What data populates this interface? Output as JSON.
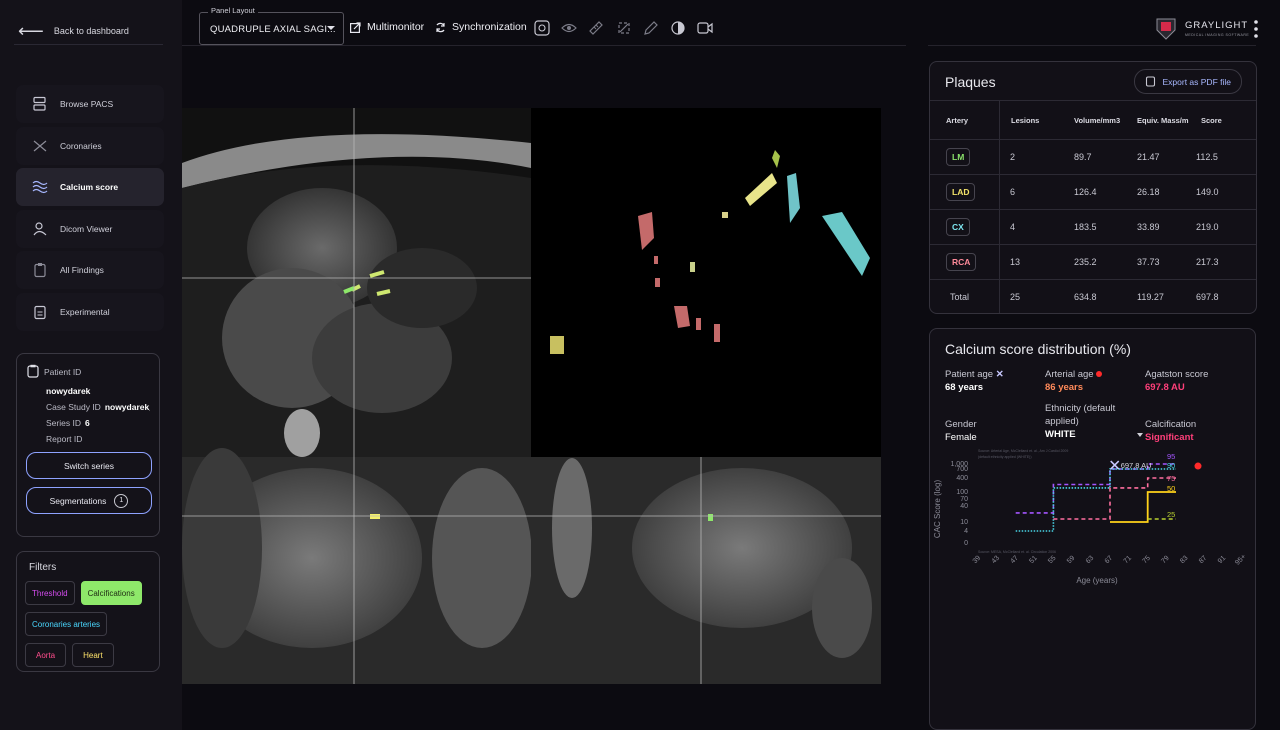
{
  "sidebar": {
    "back_label": "Back to dashboard",
    "nav": [
      {
        "label": "Browse PACS",
        "icon": "pacs-icon"
      },
      {
        "label": "Coronaries",
        "icon": "coronaries-icon"
      },
      {
        "label": "Calcium score",
        "icon": "calcium-icon",
        "active": true
      },
      {
        "label": "Dicom Viewer",
        "icon": "dicom-icon"
      },
      {
        "label": "All Findings",
        "icon": "findings-icon"
      },
      {
        "label": "Experimental",
        "icon": "experimental-icon"
      }
    ]
  },
  "patient": {
    "patient_id_label": "Patient ID",
    "patient_id_value": "nowydarek",
    "case_label": "Case Study ID",
    "case_value": "nowydarek_a...",
    "series_label": "Series ID",
    "series_value": "6",
    "report_label": "Report ID",
    "switch_label": "Switch series",
    "segmentations_label": "Segmentations",
    "segmentations_count": "1"
  },
  "filters": {
    "title": "Filters",
    "chips": [
      {
        "label": "Threshold",
        "color": "#d54cf0"
      },
      {
        "label": "Calcifications",
        "color": "#1d2a12",
        "active": true
      },
      {
        "label": "Coronaries arteries",
        "color": "#4ad7ff"
      },
      {
        "label": "Aorta",
        "color": "#ff4d8d"
      },
      {
        "label": "Heart",
        "color": "#ffe36b"
      }
    ]
  },
  "toolbar": {
    "layout_legend": "Panel Layout",
    "layout_value": "QUADRUPLE AXIAL SAGI...",
    "multimonitor_label": "Multimonitor",
    "sync_label": "Synchronization",
    "icons": [
      "crosshair-icon",
      "eye-icon",
      "ruler-icon",
      "rotate-icon",
      "pen-icon",
      "contrast-icon",
      "video-icon"
    ]
  },
  "brand": {
    "name": "GRAYLIGHT",
    "tagline": "MEDICAL IMAGING SOFTWARE"
  },
  "plaques": {
    "title": "Plaques",
    "export_label": "Export as PDF file",
    "headers": [
      "Artery",
      "Lesions",
      "Volume/mm3",
      "Equiv. Mass/m",
      "Score"
    ],
    "rows": [
      {
        "artery": "LM",
        "color": "#8be36b",
        "lesions": "2",
        "volume": "89.7",
        "mass": "21.47",
        "score": "112.5"
      },
      {
        "artery": "LAD",
        "color": "#f3e36a",
        "lesions": "6",
        "volume": "126.4",
        "mass": "26.18",
        "score": "149.0"
      },
      {
        "artery": "CX",
        "color": "#7ee6f0",
        "lesions": "4",
        "volume": "183.5",
        "mass": "33.89",
        "score": "219.0"
      },
      {
        "artery": "RCA",
        "color": "#ff8a9a",
        "lesions": "13",
        "volume": "235.2",
        "mass": "37.73",
        "score": "217.3"
      }
    ],
    "total": {
      "label": "Total",
      "lesions": "25",
      "volume": "634.8",
      "mass": "119.27",
      "score": "697.8"
    }
  },
  "distribution": {
    "title": "Calcium score distribution (%)",
    "patient_age_label": "Patient age",
    "patient_age_value": "68 years",
    "arterial_age_label": "Arterial age",
    "arterial_age_value": "86 years",
    "agatston_label": "Agatston score",
    "agatston_value": "697.8 AU",
    "gender_label": "Gender",
    "gender_value": "Female",
    "ethnicity_label": "Ethnicity (default applied)",
    "ethnicity_value": "WHITE",
    "calcification_label": "Calcification",
    "calcification_value": "Significant",
    "source_top": "Source: Arterial Age, McClelland et. al., Am J Cardiol 2009",
    "source_top2": "(default ethnicity applied (WHITE))",
    "source_bottom": "Source: MESA, McClelland et. al. Circulation 2006",
    "score_marker": "697.8 AU"
  },
  "chart_data": {
    "type": "line",
    "ylabel": "CAC Score (log)",
    "xlabel": "Age (years)",
    "x_ticks": [
      "39",
      "43",
      "47",
      "51",
      "55",
      "59",
      "63",
      "67",
      "71",
      "75",
      "79",
      "83",
      "87",
      "91",
      "95+"
    ],
    "y_ticks": [
      "1,000",
      "700",
      "400",
      "100",
      "70",
      "40",
      "10",
      "4",
      "0"
    ],
    "series": [
      {
        "name": "95",
        "color": "#a455ff",
        "values": [
          {
            "x": 47,
            "y": 22
          },
          {
            "x": 55,
            "y": 22
          },
          {
            "x": 55,
            "y": 210
          },
          {
            "x": 67,
            "y": 210
          },
          {
            "x": 67,
            "y": 700
          },
          {
            "x": 75,
            "y": 700
          },
          {
            "x": 75,
            "y": 1000
          },
          {
            "x": 81,
            "y": 1000
          }
        ]
      },
      {
        "name": "90",
        "color": "#49d6e8",
        "values": [
          {
            "x": 47,
            "y": 4
          },
          {
            "x": 55,
            "y": 4
          },
          {
            "x": 55,
            "y": 150
          },
          {
            "x": 67,
            "y": 150
          },
          {
            "x": 67,
            "y": 700
          },
          {
            "x": 81,
            "y": 700
          }
        ]
      },
      {
        "name": "75",
        "color": "#ff6fa0",
        "values": [
          {
            "x": 55,
            "y": 13
          },
          {
            "x": 67,
            "y": 13
          },
          {
            "x": 67,
            "y": 150
          },
          {
            "x": 75,
            "y": 150
          },
          {
            "x": 75,
            "y": 400
          },
          {
            "x": 81,
            "y": 400
          }
        ]
      },
      {
        "name": "50",
        "color": "#ffd21a",
        "values": [
          {
            "x": 67,
            "y": 10
          },
          {
            "x": 75,
            "y": 10
          },
          {
            "x": 75,
            "y": 100
          },
          {
            "x": 81,
            "y": 100
          }
        ]
      },
      {
        "name": "25",
        "color": "#b8d030",
        "values": [
          {
            "x": 75,
            "y": 13
          },
          {
            "x": 81,
            "y": 13
          }
        ]
      }
    ],
    "markers": [
      {
        "label": "697.8 AU",
        "x": 68,
        "y": 697.8,
        "color": "#c8c8ff",
        "shape": "cross"
      },
      {
        "x": 86,
        "y": 697.8,
        "color": "#ff2a2a",
        "shape": "dot"
      }
    ]
  },
  "colors": {
    "accent": "#8ea2ff",
    "significant": "#ff3f7a",
    "arterial": "#ff8a5a"
  }
}
